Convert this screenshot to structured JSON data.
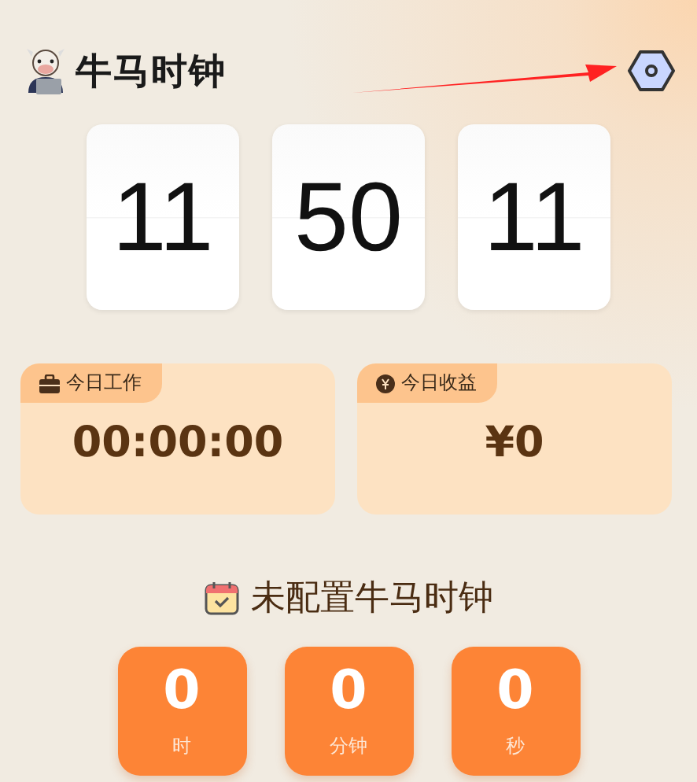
{
  "header": {
    "title": "牛马时钟"
  },
  "clock": [
    {
      "value": "11"
    },
    {
      "value": "50"
    },
    {
      "value": "11"
    }
  ],
  "stats": [
    {
      "kind": "work",
      "label": "今日工作",
      "value": "00:00:00"
    },
    {
      "kind": "income",
      "label": "今日收益",
      "value": "¥0"
    }
  ],
  "schedule": {
    "title": "未配置牛马时钟"
  },
  "countdown": [
    {
      "value": "0",
      "unit": "时"
    },
    {
      "value": "0",
      "unit": "分钟"
    },
    {
      "value": "0",
      "unit": "秒"
    }
  ]
}
